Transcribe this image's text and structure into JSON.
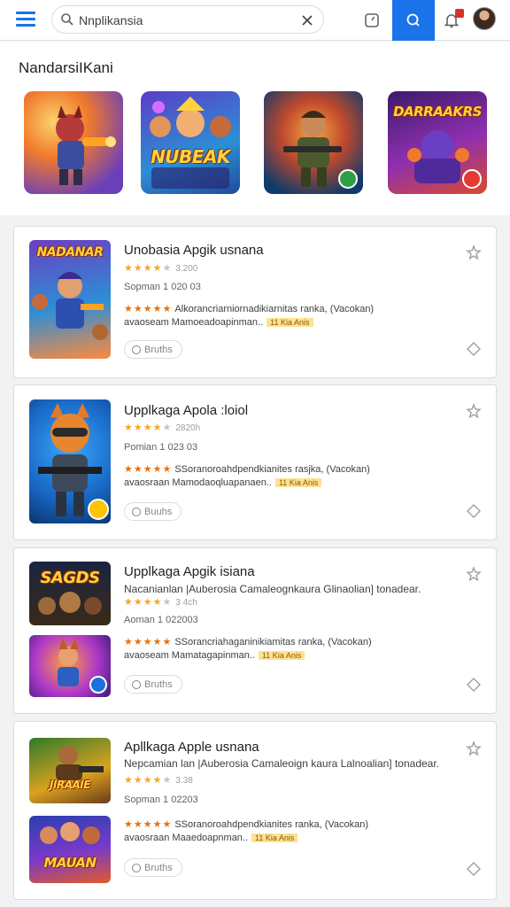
{
  "search": {
    "value": "Nnplikansia"
  },
  "featured": {
    "title": "NandarsiIKani",
    "tiles": [
      {
        "art": "hero-red",
        "label": ""
      },
      {
        "art": "crowd",
        "label": "NUBEAK"
      },
      {
        "art": "soldier",
        "label": ""
      },
      {
        "art": "purple",
        "label": "DARRAAKRS"
      }
    ]
  },
  "apps": [
    {
      "title": "Unobasia Apgik usnana",
      "desc": "",
      "rating_text": "3.200",
      "rating": 4,
      "meta": "Sopman 1 020 03",
      "review_line1": "Alkorancriarniornadikiarnitas ranka, (Vacokan)",
      "review_line2": "avaoseam Mamoeadoapinman..",
      "tag": "11 Kia Anis",
      "pill_label": "Bruths",
      "thumbs": [
        {
          "label": "NADANAR"
        }
      ]
    },
    {
      "title": "Upplkaga Apola :loiol",
      "desc": "",
      "rating_text": "2820h",
      "rating": 4,
      "meta": "Pomian 1 023 03",
      "review_line1": "SSoranoroahdpendkianites rasjka, (Vacokan)",
      "review_line2": "avaosraan Mamodaoqluapanaen..",
      "tag": "11 Kia Anis",
      "pill_label": "Buuhs",
      "thumbs": [
        {
          "label": ""
        }
      ]
    },
    {
      "title": "Upplkaga Apgik isiana",
      "desc": "Nacanianlan |Auberosia Camaleognkaura Glinaolian] tonadear.",
      "rating_text": "3 4ch",
      "rating": 4,
      "meta": "Aoman 1 022003",
      "review_line1": "SSorancriahaganinikiamitas ranka, (Vacokan)",
      "review_line2": "avaoseam Mamatagapinman..",
      "tag": "11 Kia Anis",
      "pill_label": "Bruths",
      "thumbs": [
        {
          "label": "SAGDS"
        },
        {
          "label": ""
        }
      ]
    },
    {
      "title": "Apllkaga Apple usnana",
      "desc": "Nepcamian lan |Auberosia Camaleoign kaura Lalnoalian] tonadear.",
      "rating_text": "3.38",
      "rating": 4,
      "meta": "Sopman 1 02203",
      "review_line1": "SSoranoroahdpendkianites ranka, (Vacokan)",
      "review_line2": "avaosraan Maaedoapnman..",
      "tag": "11 Kia Anis",
      "pill_label": "Bruths",
      "thumbs": [
        {
          "label": "JIRAAIE"
        },
        {
          "label": "MAUAN"
        }
      ]
    }
  ],
  "colors": {
    "accent": "#1a73e8",
    "star": "#f5a623",
    "review_star": "#e8710a",
    "notif": "#d93025"
  }
}
